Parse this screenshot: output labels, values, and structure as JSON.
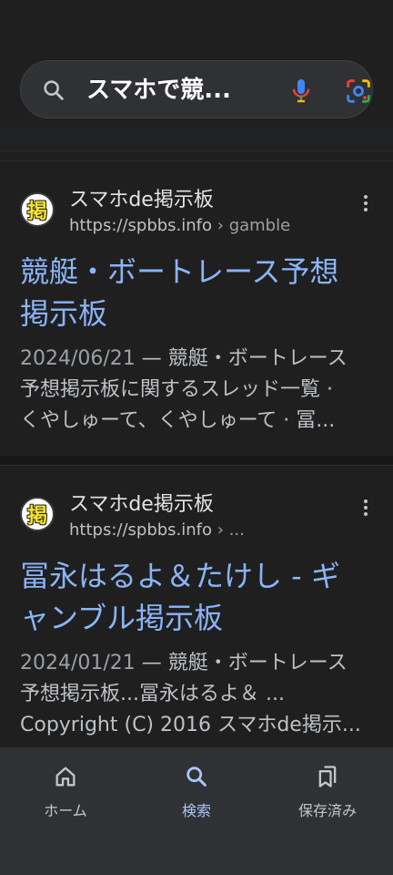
{
  "search": {
    "query": "スマホで競..."
  },
  "results": [
    {
      "favicon_char": "掲",
      "site_name": "スマホde掲示板",
      "url_host": "https://spbbs.info",
      "url_path": " › gamble",
      "title_line1": "競艇・ボートレース予想",
      "title_line2": "掲示板",
      "date": "2024/06/21",
      "snippet_line1_rest": " — 競艇・ボートレース",
      "snippet_line2": "予想掲示板に関するスレッド一覧 ·",
      "snippet_line3": "くやしゅーて、くやしゅーて · 冨..."
    },
    {
      "favicon_char": "掲",
      "site_name": "スマホde掲示板",
      "url_host": "https://spbbs.info",
      "url_path": " › ...",
      "title_line1": "冨永はるよ＆たけし - ギ",
      "title_line2": "ャンブル掲示板",
      "date": "2024/01/21",
      "snippet_line1_rest": " — 競艇・ボートレース",
      "snippet_line2": "予想掲示板...冨永はるよ＆ ...",
      "snippet_line3": "Copyright (C) 2016 スマホde掲示..."
    }
  ],
  "bottom_nav": {
    "home": "ホーム",
    "search": "検索",
    "saved": "保存済み"
  },
  "colors": {
    "link": "#8ab4f8",
    "active_nav": "#a8c7fa",
    "background": "#1f1f1f"
  }
}
